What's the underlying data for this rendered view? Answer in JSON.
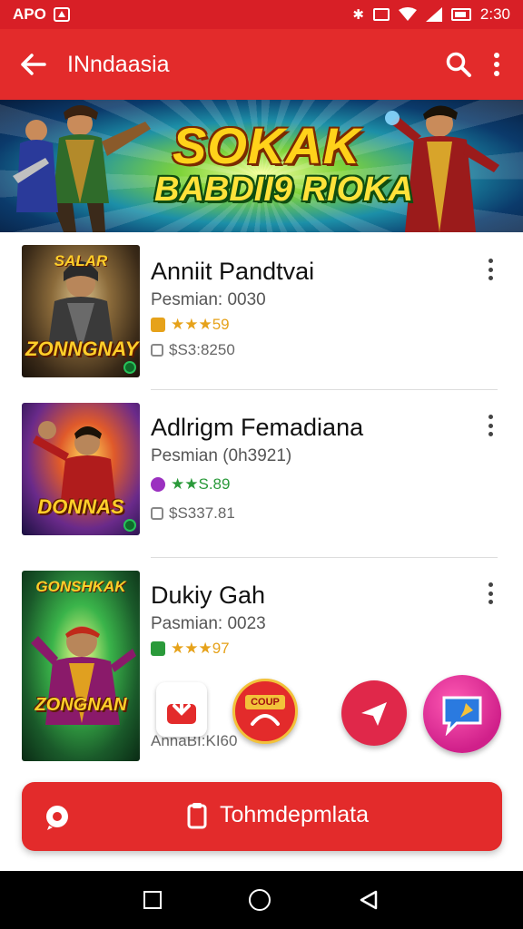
{
  "status_bar": {
    "carrier": "APO",
    "time": "2:30"
  },
  "app_bar": {
    "title": "INndaasia",
    "back_icon": "arrow-left-icon",
    "search_icon": "search-icon",
    "menu_icon": "more-vert-icon"
  },
  "banner": {
    "line1": "SOKAK",
    "line2": "BABDII9 RIOKA"
  },
  "items": [
    {
      "name": "Anniit Pandtvai",
      "sub": "Pesmian: 0030",
      "rating": "★★★59",
      "price": "$S3:8250",
      "thumb_word": "ZONNGNAY",
      "thumb_top": "SALAR",
      "rating_color": "#e6a21a",
      "chip_color": "#e6a21a"
    },
    {
      "name": "Adlrigm Femadiana",
      "sub": "Pesmian (0h3921)",
      "rating": "★★S.89",
      "price": "$S337.81",
      "thumb_word": "DONNAS",
      "thumb_top": "",
      "rating_color": "#2a9a3a",
      "chip_color": "#9b30c0"
    },
    {
      "name": "Dukiy Gah",
      "sub": "Pasmian: 0023",
      "rating": "★★★97",
      "price": "AnnaBI:KI60",
      "thumb_word": "ZONGNAN",
      "thumb_top": "GONSHKAK",
      "rating_color": "#e6a21a",
      "chip_color": "#2a9a3a"
    }
  ],
  "fab": {
    "download_label": "Download",
    "coupon_label": "COUP",
    "send_label": "Send",
    "chat_label": "Chat"
  },
  "cta": {
    "label": "Tohmdepmlata"
  },
  "nav": {
    "recents_icon": "square-icon",
    "home_icon": "circle-icon",
    "back_icon": "triangle-back-icon"
  },
  "colors": {
    "primary": "#e32b2b",
    "status": "#d81f26"
  }
}
